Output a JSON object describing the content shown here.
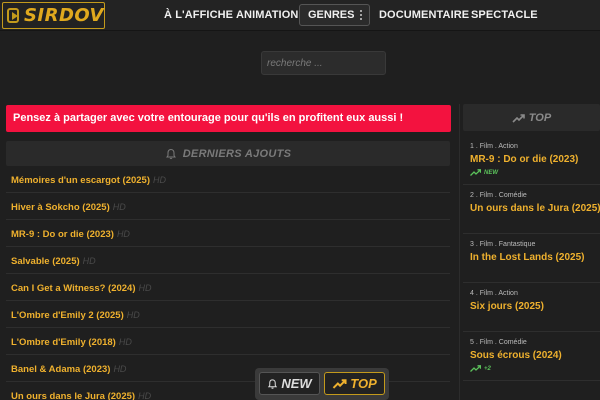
{
  "header": {
    "logo_text": "SIRDOV",
    "nav": {
      "affiche": "À L'AFFICHE",
      "animation": "ANIMATION",
      "genres": "GENRES",
      "documentaire": "DOCUMENTAIRE",
      "spectacle": "SPECTACLE"
    }
  },
  "search": {
    "placeholder": "recherche ..."
  },
  "alert": {
    "text": "Pensez à partager avec votre entourage pour qu'ils en profitent eux aussi !"
  },
  "latest": {
    "title": "DERNIERS AJOUTS",
    "items": [
      {
        "title": "Mémoires d'un escargot (2025)",
        "badge": "HD"
      },
      {
        "title": "Hiver à Sokcho (2025)",
        "badge": "HD"
      },
      {
        "title": "MR-9 : Do or die (2023)",
        "badge": "HD"
      },
      {
        "title": "Salvable (2025)",
        "badge": "HD"
      },
      {
        "title": "Can I Get a Witness? (2024)",
        "badge": "HD"
      },
      {
        "title": "L'Ombre d'Emily 2 (2025)",
        "badge": "HD"
      },
      {
        "title": "L'Ombre d'Emily (2018)",
        "badge": "HD"
      },
      {
        "title": "Banel & Adama (2023)",
        "badge": "HD"
      },
      {
        "title": "Un ours dans le Jura (2025)",
        "badge": "HD"
      }
    ]
  },
  "top": {
    "title": "TOP",
    "items": [
      {
        "meta": "1 . Film . Action",
        "title": "MR-9 : Do or die (2023)",
        "trend": "NEW",
        "trend_color": "#5bc25b"
      },
      {
        "meta": "2 . Film . Comédie",
        "title": "Un ours dans le Jura (2025)",
        "trend": ""
      },
      {
        "meta": "3 . Film . Fantastique",
        "title": "In the Lost Lands (2025)",
        "trend": ""
      },
      {
        "meta": "4 . Film . Action",
        "title": "Six jours (2025)",
        "trend": ""
      },
      {
        "meta": "5 . Film . Comédie",
        "title": "Sous écrous (2024)",
        "trend": "+2",
        "trend_color": "#5bc25b"
      }
    ]
  },
  "float_bar": {
    "new_label": "NEW",
    "top_label": "TOP"
  },
  "colors": {
    "accent": "#efb12e",
    "alert": "#f3123f",
    "background": "#1f1f1f"
  }
}
